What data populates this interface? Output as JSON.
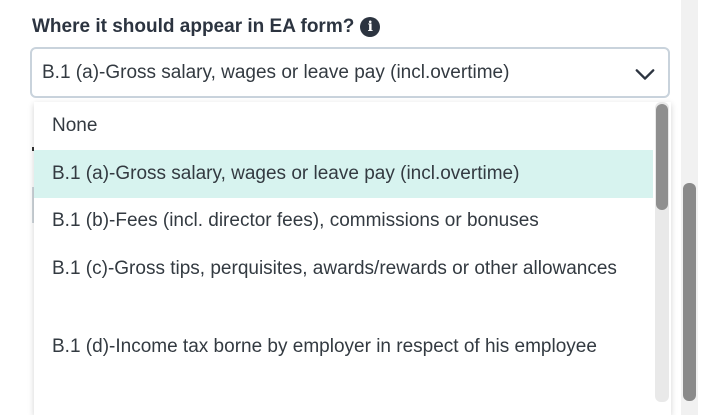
{
  "form": {
    "label": "Where it should appear in EA form?",
    "info_icon": "i",
    "selected_value": "B.1 (a)-Gross salary, wages or leave pay (incl.overtime)"
  },
  "dropdown": {
    "options": [
      "None",
      "B.1 (a)-Gross salary, wages or leave pay (incl.overtime)",
      "B.1 (b)-Fees (incl. director fees), commissions or bonuses",
      "B.1 (c)-Gross tips, perquisites, awards/rewards or other allowances",
      "B.1 (d)-Income tax borne by employer in respect of his employee"
    ],
    "highlighted_index": 1,
    "highlight_color": "#d7f3ef"
  },
  "icons": {
    "info": "info-icon",
    "chevron": "chevron-down-icon"
  }
}
